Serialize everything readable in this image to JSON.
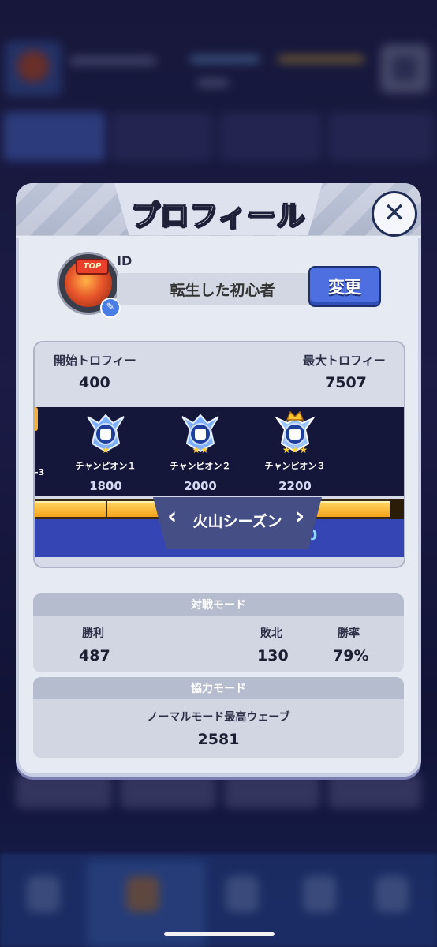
{
  "profile_dialog": {
    "title": "プロフィール",
    "id_label": "ID",
    "nickname": "転生した初心者",
    "change_label": "変更",
    "avatar_badge": "TOP"
  },
  "season": {
    "name": "火山シーズン",
    "prev_arrow": "‹",
    "next_arrow": "›",
    "start_trophy_label": "開始トロフィー",
    "start_trophy_value": "400",
    "max_trophy_label": "最大トロフィー",
    "max_trophy_value": "7507",
    "partial_tier_label": "-3",
    "tiers": [
      {
        "name": "チャンピオン１",
        "score": "1800",
        "stars": 1
      },
      {
        "name": "チャンピオン２",
        "score": "2000",
        "stars": 2
      },
      {
        "name": "チャンピオン３",
        "score": "2200",
        "stars": 3
      }
    ],
    "current_score": "7500"
  },
  "pvp": {
    "title": "対戦モード",
    "wins_label": "勝利",
    "wins": "487",
    "losses_label": "敗北",
    "losses": "130",
    "win_rate_label": "勝率",
    "win_rate": "79%"
  },
  "coop": {
    "title": "協力モード",
    "best_wave_label": "ノーマルモード最高ウェーブ",
    "best_wave": "2581"
  },
  "colors": {
    "accent_blue": "#4d6fe0",
    "progress_gold": "#f5a21a",
    "panel_bg": "#e6eaf2"
  }
}
